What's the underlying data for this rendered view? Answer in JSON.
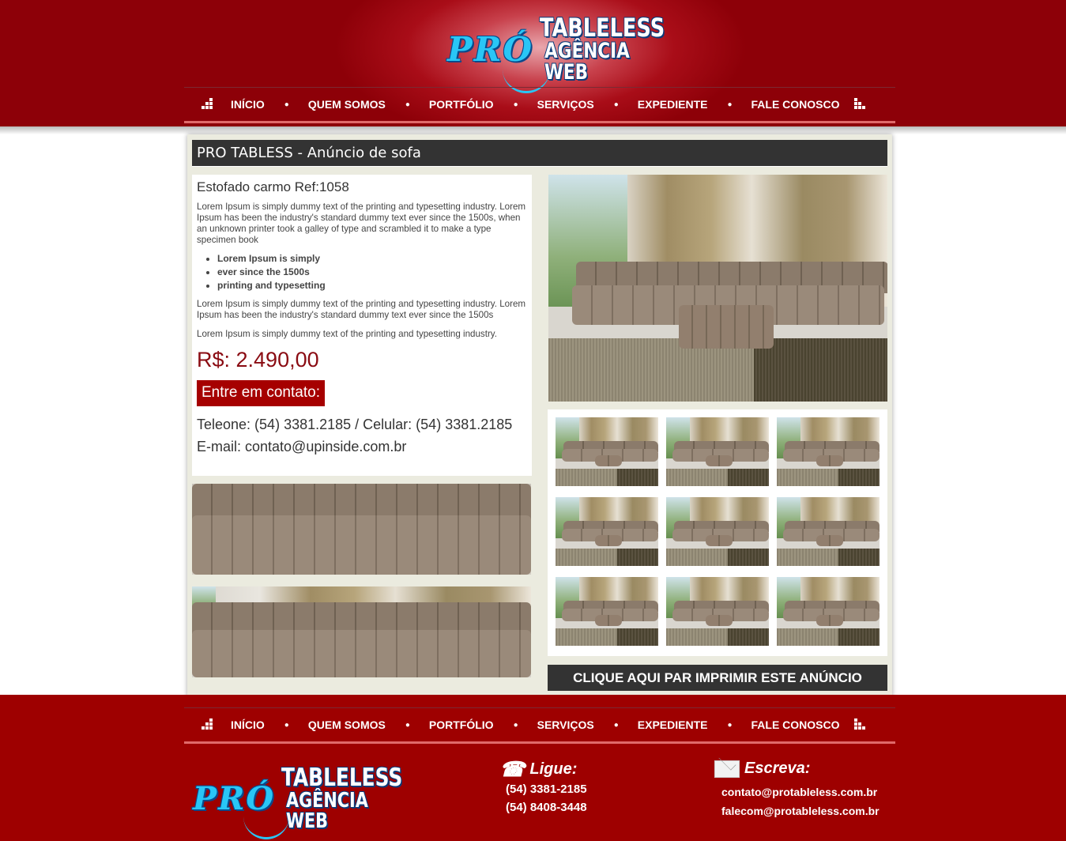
{
  "brand": {
    "logo_word": "PRÓ",
    "logo_line1": "TABLELESS",
    "logo_line2": "AGÊNCIA WEB"
  },
  "nav": {
    "items": [
      {
        "label": "INÍCIO"
      },
      {
        "label": "QUEM SOMOS"
      },
      {
        "label": "PORTFÓLIO"
      },
      {
        "label": "SERVIÇOS"
      },
      {
        "label": "EXPEDIENTE"
      },
      {
        "label": "FALE CONOSCO"
      }
    ]
  },
  "ad": {
    "title": "PRO TABLESS - Anúncio de sofa",
    "product_name": "Estofado carmo Ref:1058",
    "paragraph1": "Lorem Ipsum is simply dummy text of the printing and typesetting industry. Lorem Ipsum has been the industry's standard dummy text ever since the 1500s, when an unknown printer took a galley of type and scrambled it to make a type specimen book",
    "features": [
      "Lorem Ipsum is simply",
      "ever since the 1500s",
      "printing and typesetting"
    ],
    "paragraph2": "Lorem Ipsum is simply dummy text of the printing and typesetting industry. Lorem Ipsum has been the industry's standard dummy text ever since the 1500s",
    "paragraph3": "Lorem Ipsum is simply dummy text of the printing and typesetting industry.",
    "price": "R$: 2.490,00",
    "contact_button": "Entre em contato:",
    "phone_line": "Teleone: (54) 3381.2185 / Celular: (54) 3381.2185",
    "email_line": "E-mail: contato@upinside.com.br",
    "print_button": "CLIQUE AQUI PAR IMPRIMIR ESTE ANÚNCIO"
  },
  "footer": {
    "call_title": "Ligue:",
    "phones": [
      "(54) 3381-2185",
      "(54) 8408-3448"
    ],
    "write_title": "Escreva:",
    "emails": [
      "contato@protableless.com.br",
      "falecom@protableless.com.br"
    ]
  },
  "colors": {
    "brand_red": "#a60000",
    "dark_bar": "#333333",
    "price_red": "#8a0b12",
    "logo_blue": "#29c6f6"
  },
  "icons": [
    "bars-left-icon",
    "bars-right-icon",
    "phone-icon",
    "mail-icon"
  ]
}
